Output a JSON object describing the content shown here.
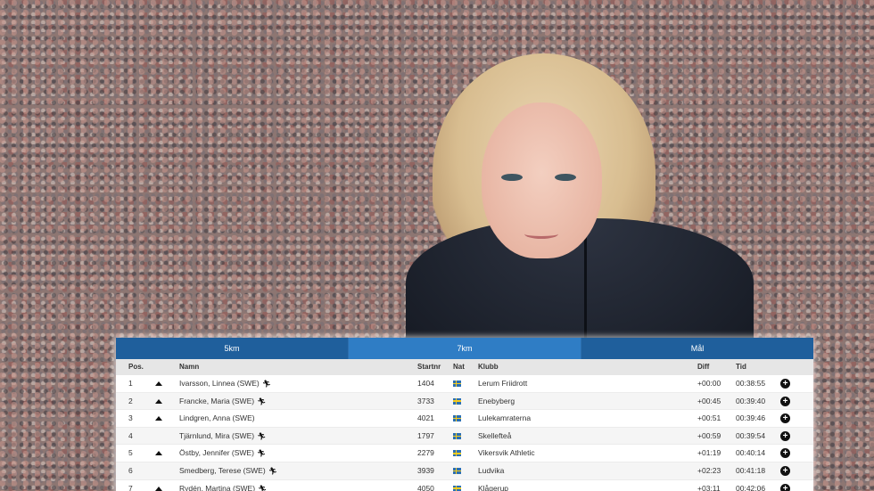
{
  "tabs": [
    {
      "label": "5km",
      "active": false
    },
    {
      "label": "7km",
      "active": true
    },
    {
      "label": "Mål",
      "active": false
    }
  ],
  "columns": {
    "pos": "Pos.",
    "name": "Namn",
    "startnr": "Startnr",
    "nat": "Nat",
    "club": "Klubb",
    "diff": "Diff",
    "time": "Tid"
  },
  "rows": [
    {
      "pos": "1",
      "up": true,
      "name": "Ivarsson, Linnea (SWE)",
      "runner_icon": true,
      "startnr": "1404",
      "nat": "swe-flag-icon",
      "club": "Lerum Friidrott",
      "diff": "+00:00",
      "time": "00:38:55"
    },
    {
      "pos": "2",
      "up": true,
      "name": "Francke, Maria (SWE)",
      "runner_icon": true,
      "startnr": "3733",
      "nat": "swe-flag-icon",
      "club": "Enebyberg",
      "diff": "+00:45",
      "time": "00:39:40"
    },
    {
      "pos": "3",
      "up": true,
      "name": "Lindgren, Anna (SWE)",
      "runner_icon": false,
      "startnr": "4021",
      "nat": "swe-flag-icon",
      "club": "Lulekamraterna",
      "diff": "+00:51",
      "time": "00:39:46"
    },
    {
      "pos": "4",
      "up": false,
      "name": "Tjärnlund, Mira (SWE)",
      "runner_icon": true,
      "startnr": "1797",
      "nat": "swe-flag-icon",
      "club": "Skellefteå",
      "diff": "+00:59",
      "time": "00:39:54"
    },
    {
      "pos": "5",
      "up": true,
      "name": "Östby, Jennifer (SWE)",
      "runner_icon": true,
      "startnr": "2279",
      "nat": "swe-flag-icon",
      "club": "Vikersvik Athletic",
      "diff": "+01:19",
      "time": "00:40:14"
    },
    {
      "pos": "6",
      "up": false,
      "name": "Smedberg, Terese (SWE)",
      "runner_icon": true,
      "startnr": "3939",
      "nat": "swe-flag-icon",
      "club": "Ludvika",
      "diff": "+02:23",
      "time": "00:41:18"
    },
    {
      "pos": "7",
      "up": true,
      "name": "Rydén, Martina (SWE)",
      "runner_icon": true,
      "startnr": "4050",
      "nat": "swe-flag-icon",
      "club": "Klågerup",
      "diff": "+03:11",
      "time": "00:42:06"
    }
  ],
  "icons": {
    "trend": "arrow-up-icon",
    "runner": "runner-icon",
    "expand": "plus-circle-icon"
  },
  "colors": {
    "tab_bg": "#1f5f9c",
    "tab_active_bg": "#2f7dc5",
    "header_bg": "#e6e6e6"
  }
}
